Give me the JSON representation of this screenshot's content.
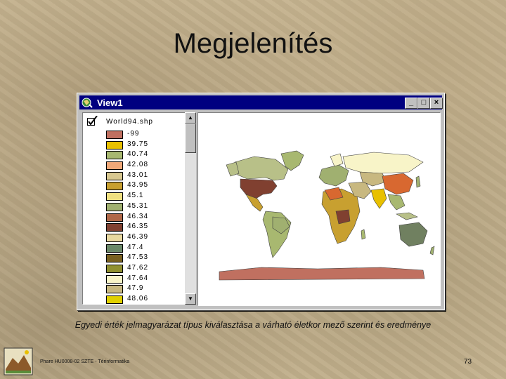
{
  "slide": {
    "title": "Megjelenítés",
    "caption": "Egyedi érték jelmagyarázat típus kiválasztása a várható életkor mező szerint és eredménye",
    "footer": "Phare HU0008-02 SZTE - Térinformatika",
    "page_number": "73"
  },
  "window": {
    "title": "View1",
    "minimize_label": "_",
    "maximize_label": "□",
    "close_label": "×"
  },
  "toc": {
    "layer_name": "World94.shp",
    "layer_visible": true,
    "legend": [
      {
        "label": "-99",
        "color": "#c07060"
      },
      {
        "label": "39.75",
        "color": "#e8c000"
      },
      {
        "label": "40.74",
        "color": "#a8b870"
      },
      {
        "label": "42.08",
        "color": "#f0a878"
      },
      {
        "label": "43.01",
        "color": "#d8c890"
      },
      {
        "label": "43.95",
        "color": "#c8a030"
      },
      {
        "label": "45.1",
        "color": "#f0e080"
      },
      {
        "label": "45.31",
        "color": "#a0b070"
      },
      {
        "label": "46.34",
        "color": "#b06848"
      },
      {
        "label": "46.35",
        "color": "#804030"
      },
      {
        "label": "46.39",
        "color": "#e8d8a0"
      },
      {
        "label": "47.4",
        "color": "#6a8868"
      },
      {
        "label": "47.53",
        "color": "#786020"
      },
      {
        "label": "47.62",
        "color": "#909030"
      },
      {
        "label": "47.64",
        "color": "#f8f4c8"
      },
      {
        "label": "47.9",
        "color": "#c8b880"
      },
      {
        "label": "48.06",
        "color": "#e0d000"
      }
    ]
  },
  "icons": {
    "app": "arcview-globe-icon",
    "check": "check-icon",
    "scroll_up": "arrow-up-icon",
    "scroll_down": "arrow-down-icon"
  },
  "map_colors": {
    "north_america": "#b8c088",
    "usa": "#804030",
    "greenland": "#a8b870",
    "south_america": "#a8b870",
    "africa": "#c8a030",
    "europe": "#a0b070",
    "russia": "#f8f4c8",
    "china": "#d86830",
    "asia": "#c8b880",
    "india": "#e8c000",
    "australia": "#708060",
    "antarctica": "#c07060",
    "outline": "#404040"
  }
}
